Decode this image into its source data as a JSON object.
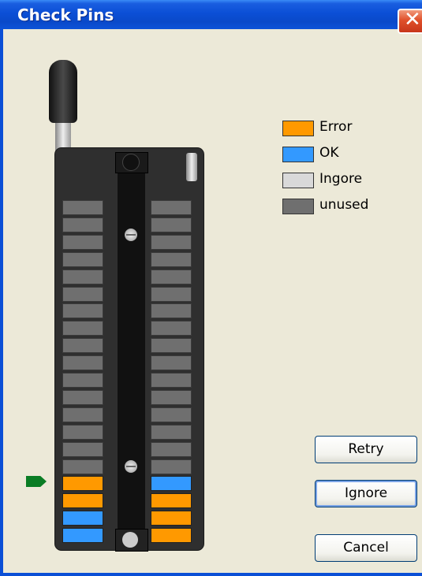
{
  "window": {
    "title": "Check Pins",
    "close_label": "✕"
  },
  "legend": [
    {
      "label": "Error",
      "color": "#FF9900"
    },
    {
      "label": "OK",
      "color": "#3399FF"
    },
    {
      "label": "Ingore",
      "color": "#D9D9D9"
    },
    {
      "label": "unused",
      "color": "#6F6F6F"
    }
  ],
  "socket": {
    "pins_per_side": 20,
    "left_column_states": [
      "unused",
      "unused",
      "unused",
      "unused",
      "unused",
      "unused",
      "unused",
      "unused",
      "unused",
      "unused",
      "unused",
      "unused",
      "unused",
      "unused",
      "unused",
      "unused",
      "error",
      "error",
      "ok",
      "ok"
    ],
    "right_column_states": [
      "unused",
      "unused",
      "unused",
      "unused",
      "unused",
      "unused",
      "unused",
      "unused",
      "unused",
      "unused",
      "unused",
      "unused",
      "unused",
      "unused",
      "unused",
      "unused",
      "ok",
      "error",
      "error",
      "error"
    ]
  },
  "buttons": {
    "retry": "Retry",
    "ignore": "Ignore",
    "cancel": "Cancel"
  }
}
